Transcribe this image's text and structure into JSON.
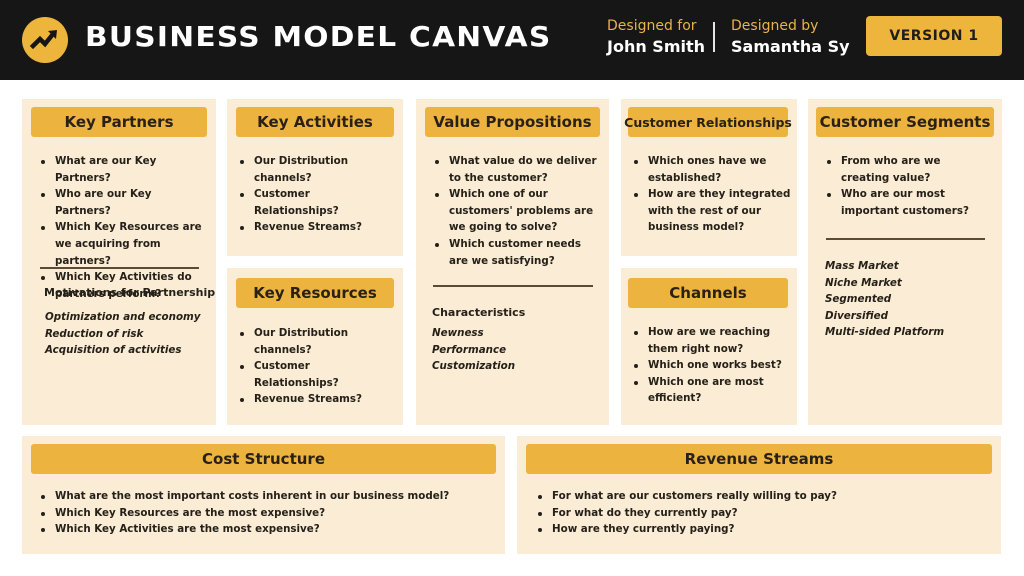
{
  "header": {
    "logo_icon": "trending-up-icon",
    "title": "BUSINESS MODEL CANVAS",
    "designed_for_label": "Designed for",
    "designed_for_value": "John Smith",
    "designed_by_label": "Designed by",
    "designed_by_value": "Samantha Sy",
    "version_label": "VERSION 1"
  },
  "colors": {
    "header_bg": "#161616",
    "accent": "#ecb43e",
    "card_bg": "#faecd5",
    "text": "#252018"
  },
  "cards": {
    "key_partners": {
      "title": "Key Partners",
      "questions": [
        "What are our Key Partners?",
        "Who are our Key Partners?",
        "Which Key Resources are we acquiring from partners?",
        "Which Key Activities do partners perform?"
      ],
      "subtitle": "Motivations for Partnership",
      "items": [
        "Optimization and economy",
        "Reduction of risk",
        "Acquisition of activities"
      ]
    },
    "key_activities": {
      "title": "Key Activities",
      "questions": [
        "Our Distribution channels?",
        "Customer Relationships?",
        "Revenue Streams?"
      ]
    },
    "key_resources": {
      "title": "Key Resources",
      "questions": [
        "Our Distribution channels?",
        "Customer Relationships?",
        "Revenue Streams?"
      ]
    },
    "value_propositions": {
      "title": "Value Propositions",
      "questions": [
        "What value do we deliver to the customer?",
        "Which one of our customers' problems are we going to solve?",
        "Which customer needs are we satisfying?"
      ],
      "subtitle": "Characteristics",
      "items": [
        "Newness",
        "Performance",
        "Customization"
      ]
    },
    "customer_relationships": {
      "title": "Customer Relationships",
      "questions": [
        "Which ones have we established?",
        "How are they integrated with the rest of our business model?"
      ]
    },
    "channels": {
      "title": "Channels",
      "questions": [
        "How are we reaching them right now?",
        "Which one works best?",
        "Which one are most efficient?"
      ]
    },
    "customer_segments": {
      "title": "Customer Segments",
      "questions": [
        "From who are we creating value?",
        "Who are our most important customers?"
      ],
      "items": [
        "Mass Market",
        "Niche Market",
        "Segmented",
        "Diversified",
        "Multi-sided Platform"
      ]
    },
    "cost_structure": {
      "title": "Cost Structure",
      "questions": [
        "What are the most important costs inherent in our business model?",
        "Which Key Resources are the most expensive?",
        "Which Key Activities are the most expensive?"
      ]
    },
    "revenue_streams": {
      "title": "Revenue Streams",
      "questions": [
        "For what are our customers really willing to pay?",
        "For what do they currently pay?",
        "How are they currently paying?"
      ]
    }
  }
}
